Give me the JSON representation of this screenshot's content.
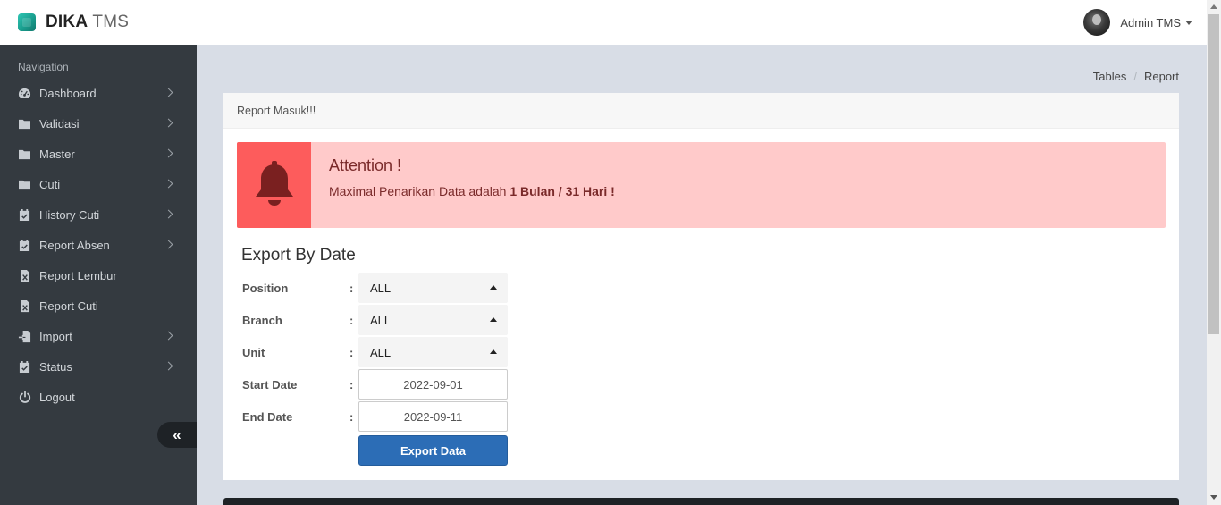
{
  "app": {
    "brand_strong": "DIKA",
    "brand_light": "TMS",
    "user_name": "Admin TMS"
  },
  "sidebar": {
    "heading": "Navigation",
    "items": [
      {
        "label": "Dashboard",
        "icon": "dashboard-icon",
        "has_submenu": true
      },
      {
        "label": "Validasi",
        "icon": "folder-icon",
        "has_submenu": true
      },
      {
        "label": "Master",
        "icon": "folder-icon",
        "has_submenu": true
      },
      {
        "label": "Cuti",
        "icon": "folder-icon",
        "has_submenu": true
      },
      {
        "label": "History Cuti",
        "icon": "calendar-check-icon",
        "has_submenu": true
      },
      {
        "label": "Report Absen",
        "icon": "calendar-check-icon",
        "has_submenu": true
      },
      {
        "label": "Report Lembur",
        "icon": "file-excel-icon",
        "has_submenu": false
      },
      {
        "label": "Report Cuti",
        "icon": "file-excel-icon",
        "has_submenu": false
      },
      {
        "label": "Import",
        "icon": "import-icon",
        "has_submenu": true
      },
      {
        "label": "Status",
        "icon": "calendar-check-icon",
        "has_submenu": true
      },
      {
        "label": "Logout",
        "icon": "power-icon",
        "has_submenu": false
      }
    ],
    "collapse_icon": "double-chevron-left-icon"
  },
  "breadcrumb": {
    "items": [
      "Tables",
      "Report"
    ],
    "separator": "/"
  },
  "card": {
    "header": "Report Masuk!!!",
    "alert": {
      "title": "Attention !",
      "text_prefix": "Maximal Penarikan Data adalah ",
      "text_strong": "1 Bulan / 31 Hari !",
      "icon": "bell-icon",
      "icon_bg": "#fd5c5c",
      "bg": "#ffcaca"
    },
    "section_title": "Export By Date",
    "form": {
      "position": {
        "label": "Position",
        "value": "ALL"
      },
      "branch": {
        "label": "Branch",
        "value": "ALL"
      },
      "unit": {
        "label": "Unit",
        "value": "ALL"
      },
      "start_date": {
        "label": "Start Date",
        "value": "2022-09-01"
      },
      "end_date": {
        "label": "End Date",
        "value": "2022-09-11"
      },
      "colon": ":",
      "submit_label": "Export Data"
    }
  },
  "colors": {
    "sidebar_bg": "#343a40",
    "content_bg": "#d8dde6",
    "primary_button": "#2c6db6"
  }
}
